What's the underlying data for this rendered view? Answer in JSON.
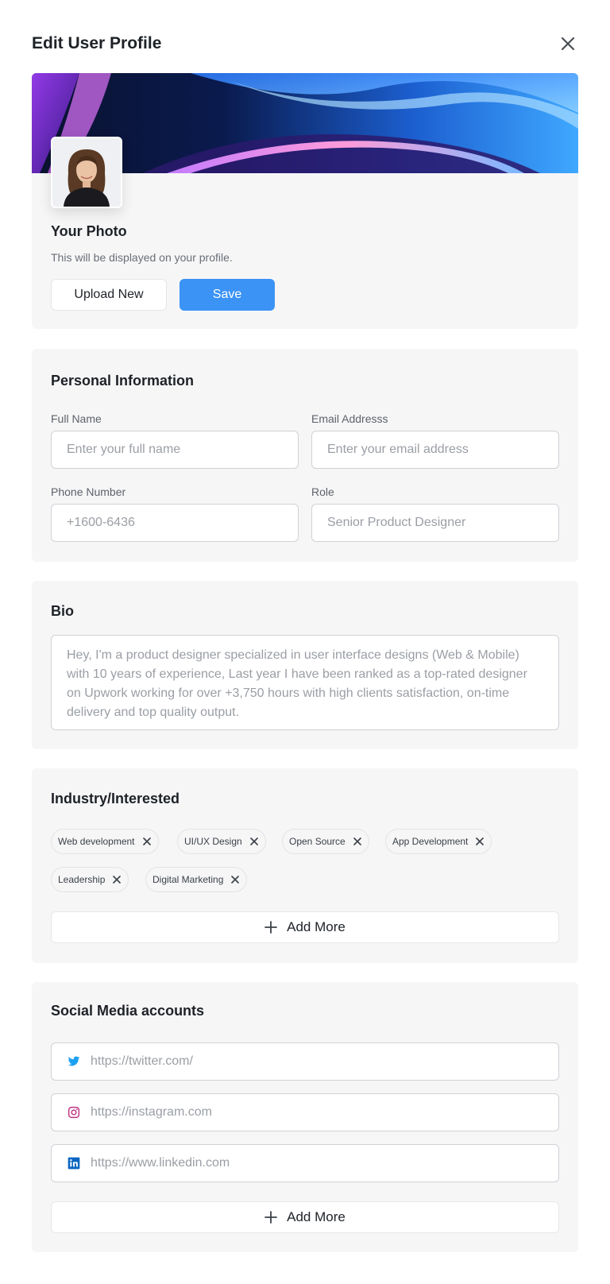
{
  "header": {
    "title": "Edit User Profile"
  },
  "photo": {
    "label": "Your Photo",
    "hint": "This will be displayed on your profile.",
    "upload_label": "Upload New",
    "save_label": "Save"
  },
  "personal": {
    "title": "Personal Information",
    "full_name": {
      "label": "Full Name",
      "placeholder": "Enter your full name"
    },
    "email": {
      "label": "Email Addresss",
      "placeholder": "Enter your email address"
    },
    "phone": {
      "label": "Phone Number",
      "placeholder": "+1600-6436"
    },
    "role": {
      "label": "Role",
      "placeholder": "Senior Product Designer"
    }
  },
  "bio": {
    "title": "Bio",
    "text": "Hey, I'm a product designer specialized in user interface designs (Web & Mobile) with 10 years of experience, Last year I have been ranked as a top-rated designer on Upwork working for over +3,750 hours with high clients satisfaction, on-time delivery and top quality output."
  },
  "industry": {
    "title": "Industry/Interested",
    "tags": [
      "Web development",
      "UI/UX Design",
      "Open Source",
      "App Development",
      "Leadership",
      "Digital Marketing"
    ],
    "add_more_label": "Add More"
  },
  "social": {
    "title": "Social Media accounts",
    "accounts": [
      {
        "icon": "twitter-icon",
        "placeholder": "https://twitter.com/"
      },
      {
        "icon": "instagram-icon",
        "placeholder": "https://instagram.com"
      },
      {
        "icon": "linkedin-icon",
        "placeholder": "https://www.linkedin.com"
      }
    ],
    "add_more_label": "Add More"
  },
  "colors": {
    "primary": "#3b93f5",
    "twitter": "#1da1f2",
    "instagram": "#c13584",
    "linkedin": "#0a66c2"
  }
}
